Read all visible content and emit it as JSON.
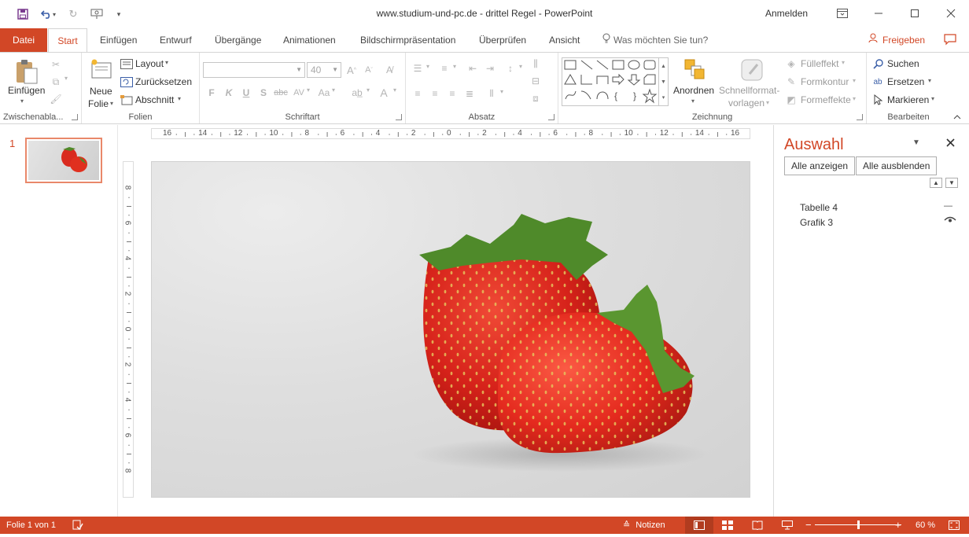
{
  "window": {
    "title": "www.studium-und-pc.de - drittel Regel  -  PowerPoint",
    "signin": "Anmelden"
  },
  "tabs": {
    "file": "Datei",
    "items": [
      "Start",
      "Einfügen",
      "Entwurf",
      "Übergänge",
      "Animationen",
      "Bildschirmpräsentation",
      "Überprüfen",
      "Ansicht"
    ],
    "active": "Start",
    "tell_me": "Was möchten Sie tun?",
    "share": "Freigeben"
  },
  "ribbon": {
    "clipboard": {
      "paste": "Einfügen",
      "label": "Zwischenabla..."
    },
    "slides": {
      "new_slide_1": "Neue",
      "new_slide_2": "Folie",
      "layout": "Layout",
      "reset": "Zurücksetzen",
      "section": "Abschnitt",
      "label": "Folien"
    },
    "font": {
      "font_name": "",
      "font_size": "40",
      "bold": "F",
      "italic": "K",
      "underline": "U",
      "shadow": "S",
      "strike": "abc",
      "spacing": "AV",
      "case": "Aa",
      "label": "Schriftart"
    },
    "paragraph": {
      "label": "Absatz"
    },
    "drawing": {
      "arrange": "Anordnen",
      "quick_styles_1": "Schnellformat-",
      "quick_styles_2": "vorlagen",
      "fill": "Fülleffekt",
      "outline": "Formkontur",
      "effects": "Formeffekte",
      "label": "Zeichnung"
    },
    "editing": {
      "find": "Suchen",
      "replace": "Ersetzen",
      "select": "Markieren",
      "label": "Bearbeiten"
    }
  },
  "thumbnails": {
    "slide_number": "1"
  },
  "ruler": {
    "h_labels": [
      "16",
      "14",
      "12",
      "10",
      "8",
      "6",
      "4",
      "2",
      "0",
      "2",
      "4",
      "6",
      "8",
      "10",
      "12",
      "14",
      "16"
    ],
    "v_labels": [
      "8",
      "6",
      "4",
      "2",
      "0",
      "2",
      "4",
      "6",
      "8"
    ]
  },
  "selection_pane": {
    "title": "Auswahl",
    "show_all": "Alle anzeigen",
    "hide_all": "Alle ausblenden",
    "items": [
      {
        "name": "Tabelle 4",
        "visibility": "—"
      },
      {
        "name": "Grafik 3",
        "visibility": "👁"
      }
    ]
  },
  "status": {
    "slide_info": "Folie 1 von 1",
    "notes": "Notizen",
    "zoom": "60 %",
    "zoom_level": 0.5
  },
  "colors": {
    "accent": "#d24726"
  }
}
